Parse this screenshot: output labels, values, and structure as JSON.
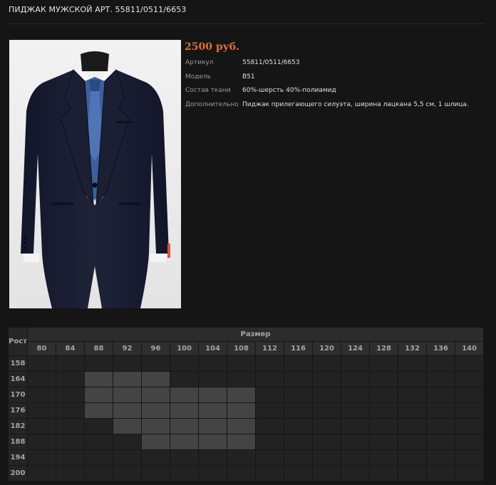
{
  "product": {
    "title": "ПИДЖАК МУЖСКОЙ АРТ. 55811/0511/6653",
    "price": "2500 руб.",
    "specs": [
      {
        "key": "Артикул",
        "value": "55811/0511/6653"
      },
      {
        "key": "Модель",
        "value": "B51"
      },
      {
        "key": "Состав ткани",
        "value": "60%-шерсть 40%-полиамид"
      },
      {
        "key": "Дополнительно",
        "value": "Пиджак прилегающего силуэта, ширина лацкана 5,5 см, 1 шлица."
      }
    ]
  },
  "size_grid": {
    "height_header": "Рост",
    "size_header": "Размер",
    "sizes": [
      "80",
      "84",
      "88",
      "92",
      "96",
      "100",
      "104",
      "108",
      "112",
      "116",
      "120",
      "124",
      "128",
      "132",
      "136",
      "140"
    ],
    "heights": [
      "158",
      "164",
      "170",
      "176",
      "182",
      "188",
      "194",
      "200"
    ],
    "available": {
      "164": [
        "88",
        "92",
        "96"
      ],
      "170": [
        "88",
        "92",
        "96",
        "100",
        "104",
        "108"
      ],
      "176": [
        "88",
        "92",
        "96",
        "100",
        "104",
        "108"
      ],
      "182": [
        "92",
        "96",
        "100",
        "104",
        "108"
      ],
      "188": [
        "96",
        "100",
        "104",
        "108"
      ]
    }
  },
  "colors": {
    "price": "#e0713a",
    "available_cell": "#444444",
    "empty_cell": "#222222"
  }
}
